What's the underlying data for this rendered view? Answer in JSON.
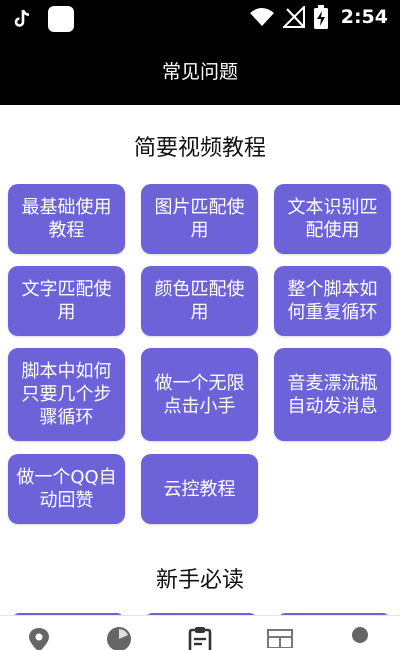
{
  "status_bar": {
    "time": "2:54"
  },
  "header": {
    "title": "常见问题"
  },
  "sections": {
    "tutorials_title": "简要视频教程",
    "newbie_title": "新手必读"
  },
  "tutorials": [
    {
      "label": "最基础使用教程"
    },
    {
      "label": "图片匹配使用"
    },
    {
      "label": "文本识别匹配使用"
    },
    {
      "label": "文字匹配使用"
    },
    {
      "label": "颜色匹配使用"
    },
    {
      "label": "整个脚本如何重复循环"
    },
    {
      "label": "脚本中如何只要几个步骤循环"
    },
    {
      "label": "做一个无限点击小手"
    },
    {
      "label": "音麦漂流瓶自动发消息"
    },
    {
      "label": "做一个QQ自动回赞"
    },
    {
      "label": "云控教程"
    }
  ],
  "bottom_nav": [
    {
      "icon": "location-pin-icon"
    },
    {
      "icon": "pie-chart-icon"
    },
    {
      "icon": "clipboard-icon"
    },
    {
      "icon": "layout-icon"
    },
    {
      "icon": "profile-icon"
    }
  ],
  "colors": {
    "accent": "#6d62d8",
    "bar": "#000000"
  }
}
